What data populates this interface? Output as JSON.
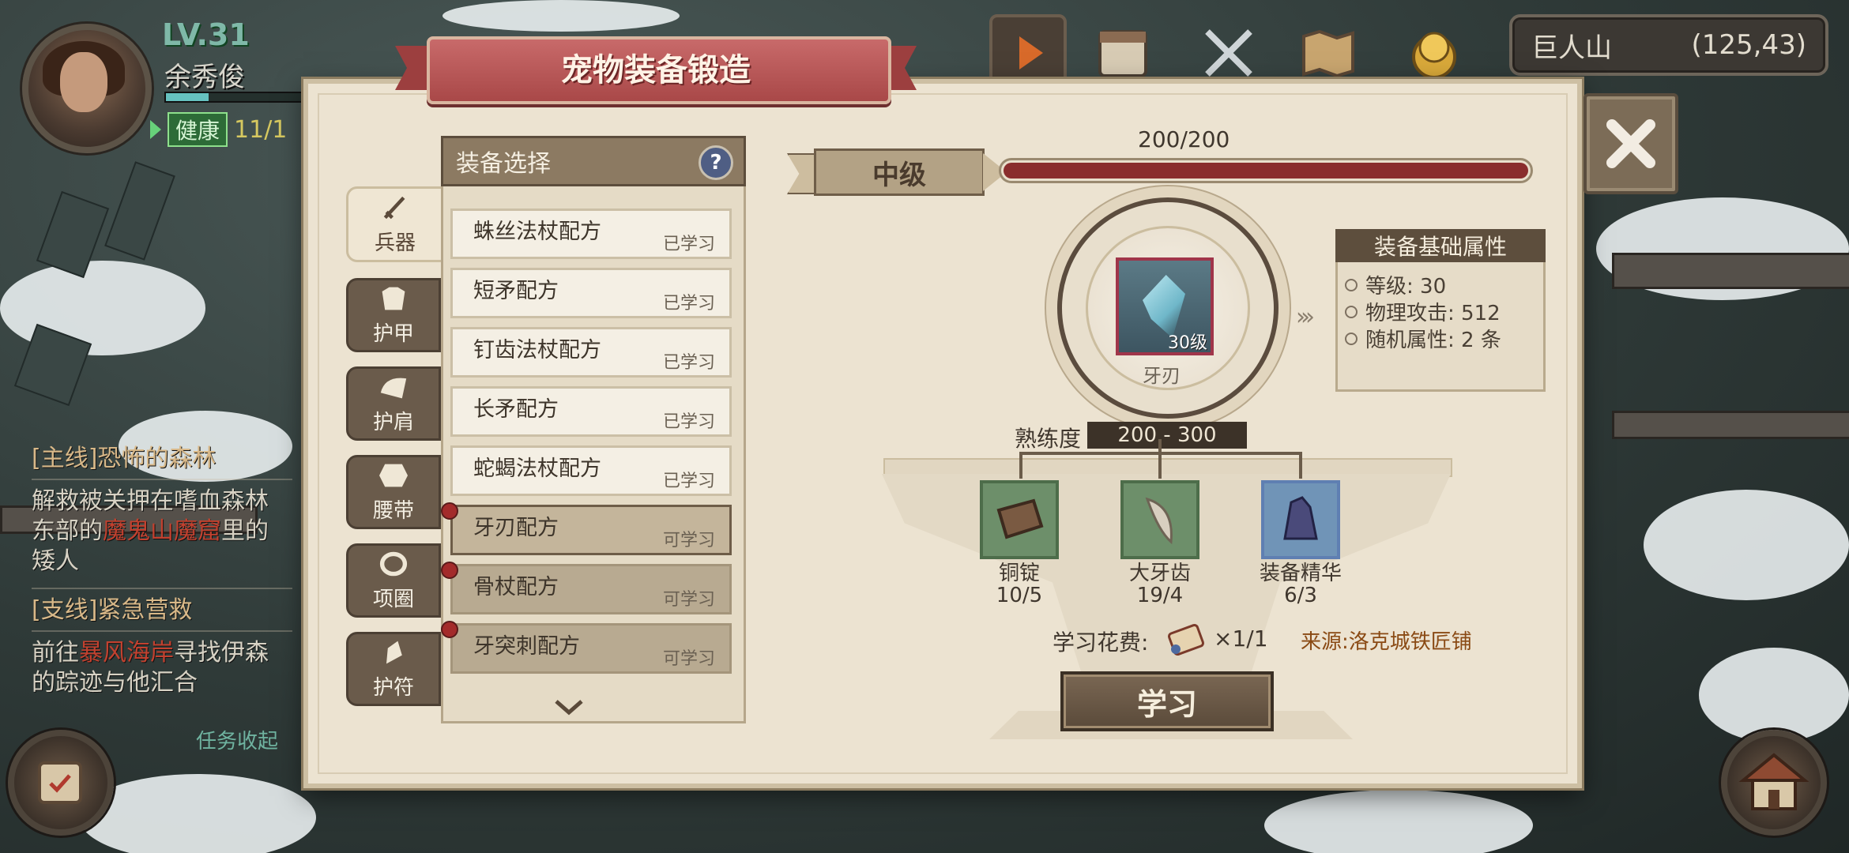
{
  "player": {
    "level": "LV.31",
    "name": "余秀俊",
    "status": "健康",
    "hp": "11/1"
  },
  "quests": [
    {
      "title": "[主线]恐怖的森林",
      "desc_a": "解救被关押在嗜血森林",
      "desc_b": "东部的",
      "desc_red": "魔鬼山魔窟",
      "desc_c": "里的",
      "desc_d": "矮人"
    },
    {
      "title": "[支线]紧急营救",
      "desc_a": "前往",
      "desc_red": "暴风海岸",
      "desc_c": "寻找伊森",
      "desc_d": "的踪迹与他汇合"
    }
  ],
  "quest_collapse": "任务收起",
  "location": {
    "name": "巨人山",
    "coords": "(125,43)"
  },
  "panel": {
    "title": "宠物装备锻造"
  },
  "categories": [
    {
      "label": "兵器",
      "active": true,
      "icon": "sword-icon"
    },
    {
      "label": "护甲",
      "active": false,
      "icon": "armor-icon"
    },
    {
      "label": "护肩",
      "active": false,
      "icon": "shoulder-icon"
    },
    {
      "label": "腰带",
      "active": false,
      "icon": "belt-icon"
    },
    {
      "label": "项圈",
      "active": false,
      "icon": "collar-icon"
    },
    {
      "label": "护符",
      "active": false,
      "icon": "amulet-icon"
    }
  ],
  "equipment_list": {
    "header": "装备选择",
    "help": "?",
    "items": [
      {
        "name": "蛛丝法杖配方",
        "status": "已学习"
      },
      {
        "name": "短矛配方",
        "status": "已学习"
      },
      {
        "name": "钉齿法杖配方",
        "status": "已学习"
      },
      {
        "name": "长矛配方",
        "status": "已学习"
      },
      {
        "name": "蛇蝎法杖配方",
        "status": "已学习"
      },
      {
        "name": "牙刃配方",
        "status": "可学习",
        "selected": true
      },
      {
        "name": "骨杖配方",
        "status": "可学习"
      },
      {
        "name": "牙突刺配方",
        "status": "可学习"
      }
    ]
  },
  "forge": {
    "tier": "中级",
    "progress_text": "200/200",
    "progress_fraction": 1.0,
    "item_name": "牙刃",
    "item_level": "30级",
    "proficiency_label": "熟练度",
    "proficiency_value": "200 - 300"
  },
  "attributes": {
    "header": "装备基础属性",
    "rows": [
      "等级: 30",
      "物理攻击: 512",
      "随机属性: 2 条"
    ]
  },
  "materials": [
    {
      "name": "铜锭",
      "count": "10/5",
      "icon": "copper-ingot-icon"
    },
    {
      "name": "大牙齿",
      "count": "19/4",
      "icon": "big-tooth-icon"
    },
    {
      "name": "装备精华",
      "count": "6/3",
      "icon": "equipment-essence-icon"
    }
  ],
  "cost": {
    "label": "学习花费:",
    "value": "×1/1",
    "source": "来源:洛克城铁匠铺"
  },
  "learn_button": "学习",
  "colors": {
    "ribbon": "#b85252",
    "progress": "#8a2d2d",
    "panel": "#ece3d1",
    "source_text": "#8a4a14"
  }
}
